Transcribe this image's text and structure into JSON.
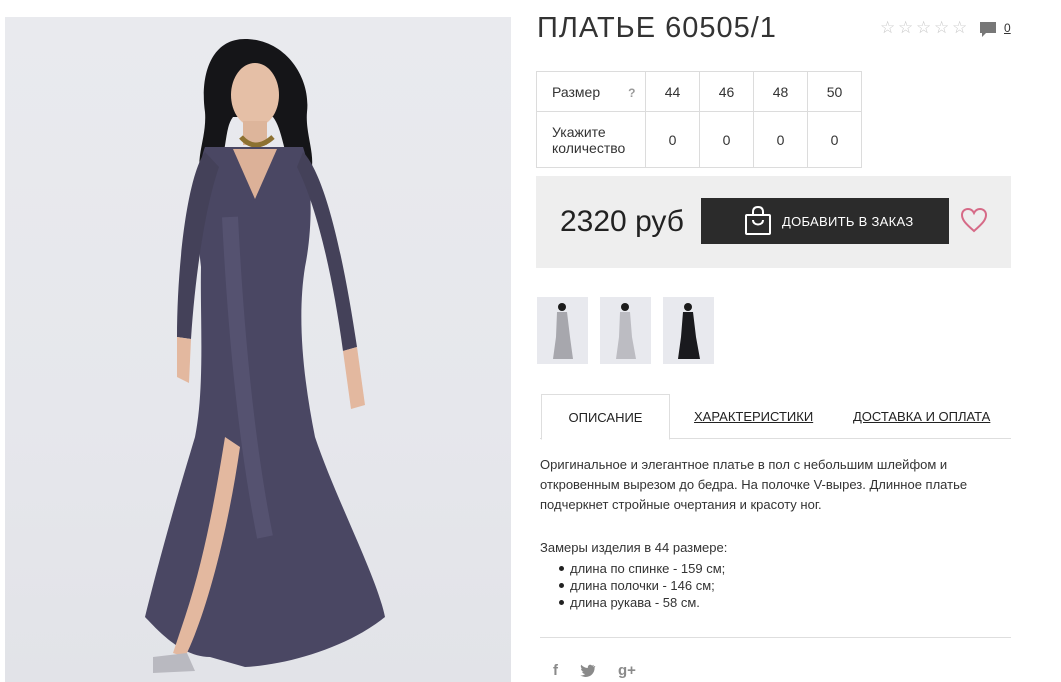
{
  "product": {
    "title": "ПЛАТЬЕ 60505/1",
    "rating_icon": "star-outline-icon",
    "comments_count": "0"
  },
  "sizes": {
    "size_label": "Размер",
    "help": "?",
    "qty_label": "Укажите количество",
    "values": [
      "44",
      "46",
      "48",
      "50"
    ],
    "quantities": [
      "0",
      "0",
      "0",
      "0"
    ]
  },
  "purchase": {
    "price": "2320 руб",
    "order_button": "ДОБАВИТЬ В ЗАКАЗ"
  },
  "tabs": {
    "description": "ОПИСАНИЕ",
    "characteristics": "ХАРАКТЕРИСТИКИ",
    "delivery": "ДОСТАВКА И ОПЛАТА"
  },
  "description": {
    "text": "Оригинальное и элегантное платье в пол с небольшим шлейфом и откровенным вырезом до бедра. На полочке V-вырез. Длинное платье подчеркнет стройные очертания и красоту ног.",
    "measures_title": "Замеры изделия в 44 размере:",
    "measures": [
      "длина по спинке - 159 см;",
      "длина полочки - 146 см;",
      "длина рукава - 58 см."
    ]
  },
  "social": {
    "facebook": "f",
    "twitter": "twitter-icon",
    "googleplus": "g+"
  },
  "colors": {
    "dark_button": "#2b2b2b",
    "heart": "#d66a87",
    "dress": "#4a4763"
  }
}
